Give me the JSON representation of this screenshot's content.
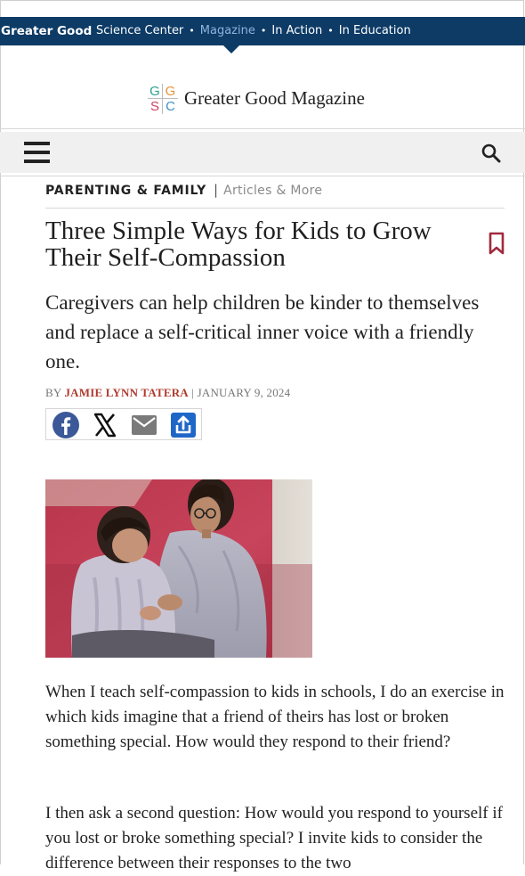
{
  "network_bar": {
    "brand": "Greater Good",
    "nav": [
      {
        "label": "Science Center",
        "active": false
      },
      {
        "label": "Magazine",
        "active": true
      },
      {
        "label": "In Action",
        "active": false
      },
      {
        "label": "In Education",
        "active": false
      }
    ],
    "separator": "•"
  },
  "logo": {
    "letters": [
      "G",
      "G",
      "S",
      "C"
    ],
    "text": "Greater Good Magazine"
  },
  "menu_bar": {
    "menu_icon": "hamburger-icon",
    "search_icon": "search-icon"
  },
  "article": {
    "category": "PARENTING & FAMILY",
    "category_sep": "|",
    "category_sub": "Articles & More",
    "title": "Three Simple Ways for Kids to Grow Their Self-Compassion",
    "bookmark_icon": "bookmark-icon",
    "dek": "Caregivers can help children be kinder to themselves and replace a self-critical inner voice with a friendly one.",
    "byline_prefix": "BY",
    "author": "JAMIE LYNN TATERA",
    "byline_sep": "|",
    "date": "JANUARY 9, 2024",
    "share_buttons": [
      {
        "icon": "facebook-icon",
        "color": "#3b5998"
      },
      {
        "icon": "x-icon",
        "color": "#111111"
      },
      {
        "icon": "email-icon",
        "color": "#7a7a7a"
      },
      {
        "icon": "share-icon",
        "color": "#1f67c7"
      }
    ],
    "image": "photo of a woman and a young girl sitting together on a red couch",
    "paragraphs": [
      "When I teach self-compassion to kids in schools, I do an exercise in which kids imagine that a friend of theirs has lost or broken something special. How would they respond to their friend?",
      "I then ask a second question: How would you respond to yourself if you lost or broke something special? I invite kids to consider the difference between their responses to the two"
    ]
  },
  "colors": {
    "network_bar": "#0d3b66",
    "active_nav": "#8fb3db",
    "author": "#b03a2e",
    "menu_bar": "#f0f0f0"
  }
}
